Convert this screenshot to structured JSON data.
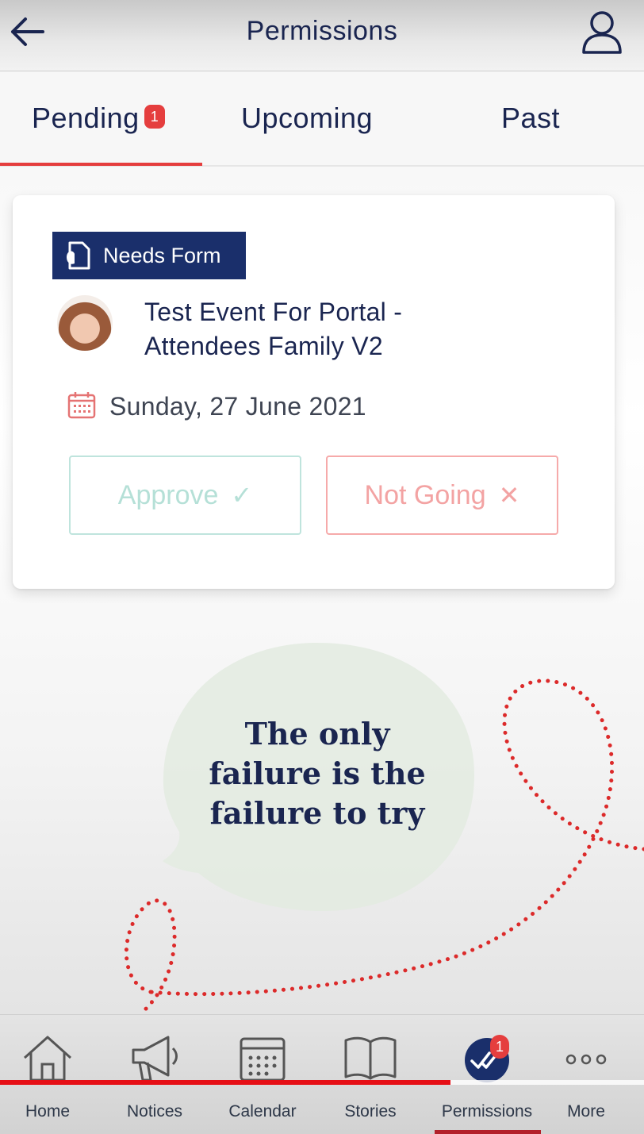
{
  "header": {
    "title": "Permissions",
    "back_icon": "arrow-left-icon",
    "profile_icon": "user-profile-icon"
  },
  "tabs": [
    {
      "label": "Pending",
      "badge": "1",
      "active": true
    },
    {
      "label": "Upcoming",
      "active": false
    },
    {
      "label": "Past",
      "active": false
    }
  ],
  "card": {
    "tag": "Needs Form",
    "tag_icon": "document-hand-icon",
    "title": "Test Event For Portal - Attendees Family V2",
    "date": "Sunday, 27 June 2021",
    "date_icon": "calendar-icon",
    "approve_label": "Approve",
    "approve_glyph": "✓",
    "not_going_label": "Not Going",
    "not_going_glyph": "✕"
  },
  "illustration": {
    "quote_line1": "The only",
    "quote_line2": "failure is the",
    "quote_line3": "failure to try"
  },
  "bottom_nav": {
    "items": [
      {
        "label": "Home",
        "icon": "home-icon"
      },
      {
        "label": "Notices",
        "icon": "megaphone-icon"
      },
      {
        "label": "Calendar",
        "icon": "calendar-icon"
      },
      {
        "label": "Stories",
        "icon": "book-icon"
      },
      {
        "label": "Permissions",
        "icon": "double-check-icon",
        "badge": "1",
        "active": true
      },
      {
        "label": "More",
        "icon": "more-dots-icon"
      }
    ],
    "video_progress": 0.7
  },
  "colors": {
    "navy": "#1a2f6b",
    "accent_red": "#e53e3e",
    "approve_border": "#bfe4dd",
    "notgoing_border": "#f6aaaa"
  }
}
